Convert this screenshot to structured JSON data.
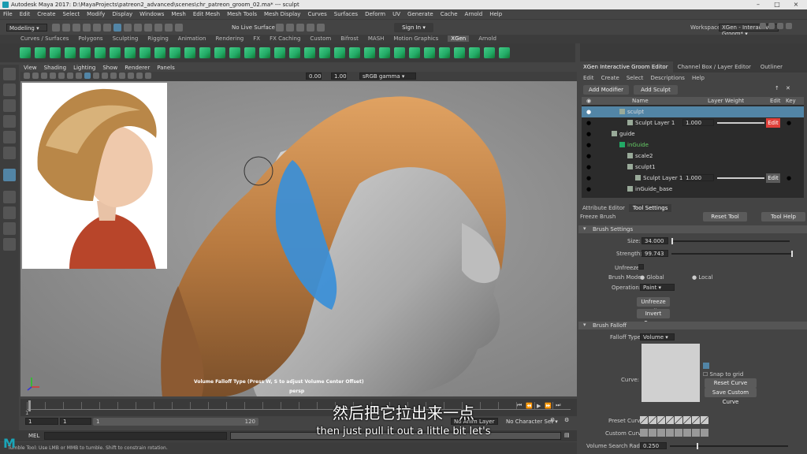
{
  "window": {
    "title": "Autodesk Maya 2017: D:\\MayaProjects\\patreon2_advanced\\scenes\\chr_patreon_groom_02.ma* --- sculpt"
  },
  "menubar": {
    "items": [
      "File",
      "Edit",
      "Create",
      "Select",
      "Modify",
      "Display",
      "Windows",
      "Mesh",
      "Edit Mesh",
      "Mesh Tools",
      "Mesh Display",
      "Curves",
      "Surfaces",
      "Deform",
      "UV",
      "Generate",
      "Cache",
      "Arnold",
      "Help"
    ]
  },
  "status": {
    "mode": "Modeling",
    "live_surface": "No Live Surface",
    "sign_in": "Sign In",
    "workspace_label": "Workspace :",
    "workspace_value": "XGen - Interactive Groom*"
  },
  "shelf": {
    "tabs": [
      "Curves / Surfaces",
      "Polygons",
      "Sculpting",
      "Rigging",
      "Animation",
      "Rendering",
      "FX",
      "FX Caching",
      "Custom",
      "Bifrost",
      "MASH",
      "Motion Graphics",
      "XGen",
      "Arnold"
    ],
    "active_tab": "XGen"
  },
  "viewport": {
    "menu": [
      "View",
      "Shading",
      "Lighting",
      "Show",
      "Renderer",
      "Panels"
    ],
    "exposure": "0.00",
    "gamma": "1.00",
    "colorspace": "sRGB gamma",
    "hud_message": "Volume Falloff Type (Press W, S to adjust Volume Center Offset)",
    "camera": "persp"
  },
  "timeline": {
    "start": "1",
    "end": "120",
    "range_start": "1",
    "range_start2": "1",
    "range_val": "1",
    "range_end": "120",
    "no_anim_layer": "No Anim Layer",
    "no_char_set": "No Character Set"
  },
  "cmdline": {
    "label": "MEL"
  },
  "helpline": {
    "text": "Tumble Tool: Use LMB or MMB to tumble. Shift to constrain rotation."
  },
  "subtitle": {
    "zh": "然后把它拉出来一点",
    "en": "then just pull it out a little bit let's"
  },
  "panel": {
    "tabs": [
      "XGen Interactive Groom Editor",
      "Channel Box / Layer Editor",
      "Outliner"
    ],
    "menu": [
      "Edit",
      "Create",
      "Select",
      "Descriptions",
      "Help"
    ],
    "add_modifier": "Add Modifier",
    "add_sculpt_layer": "Add Sculpt Layer",
    "cols": {
      "name": "Name",
      "weight": "Layer Weight",
      "edit": "Edit",
      "key": "Key"
    },
    "rows": [
      {
        "name": "sculpt",
        "weight": "",
        "edit": "",
        "selected": true,
        "indent": 3
      },
      {
        "name": "Sculpt Layer 1",
        "weight": "1.000",
        "edit": "Edit",
        "editRed": true,
        "indent": 4
      },
      {
        "name": "guide",
        "weight": "",
        "edit": "",
        "indent": 2
      },
      {
        "name": "inGuide",
        "weight": "",
        "edit": "",
        "indent": 3,
        "green": true
      },
      {
        "name": "scale2",
        "weight": "",
        "edit": "",
        "indent": 4
      },
      {
        "name": "sculpt1",
        "weight": "",
        "edit": "",
        "indent": 4
      },
      {
        "name": "Sculpt Layer 1",
        "weight": "1.000",
        "edit": "Edit",
        "indent": 5
      },
      {
        "name": "inGuide_base",
        "weight": "",
        "edit": "",
        "indent": 4
      }
    ],
    "lower_tabs": [
      "Attribute Editor",
      "Tool Settings"
    ],
    "tool_name": "Freeze Brush",
    "reset_tool": "Reset Tool",
    "tool_help": "Tool Help",
    "brush_settings": "Brush Settings",
    "size_label": "Size:",
    "size": "34.000",
    "strength_label": "Strength:",
    "strength": "99.743",
    "unfreeze_label": "Unfreeze:",
    "brush_mode_label": "Brush Mode:",
    "brush_mode_global": "Global",
    "brush_mode_local": "Local",
    "operation_label": "Operation:",
    "operation": "Paint",
    "unfreeze_all": "Unfreeze All",
    "invert_frozen": "Invert Frozen",
    "brush_falloff": "Brush Falloff",
    "falloff_type_label": "Falloff Type:",
    "falloff_type": "Volume",
    "curve_label": "Curve:",
    "snap_to_grid": "Snap to grid",
    "reset_curve": "Reset Curve",
    "save_custom_curve": "Save Custom Curve",
    "preset_curve_label": "Preset Curve:",
    "custom_curve_label": "Custom Curve:",
    "volume_radius_label": "Volume Search Radius:",
    "volume_radius": "0.250"
  },
  "colors": {
    "accent": "#5285a6",
    "selected_row": "#5285a6",
    "edit_red": "#e0403a",
    "hair": "#c8874a",
    "brush_blue": "#3a8fd8"
  }
}
